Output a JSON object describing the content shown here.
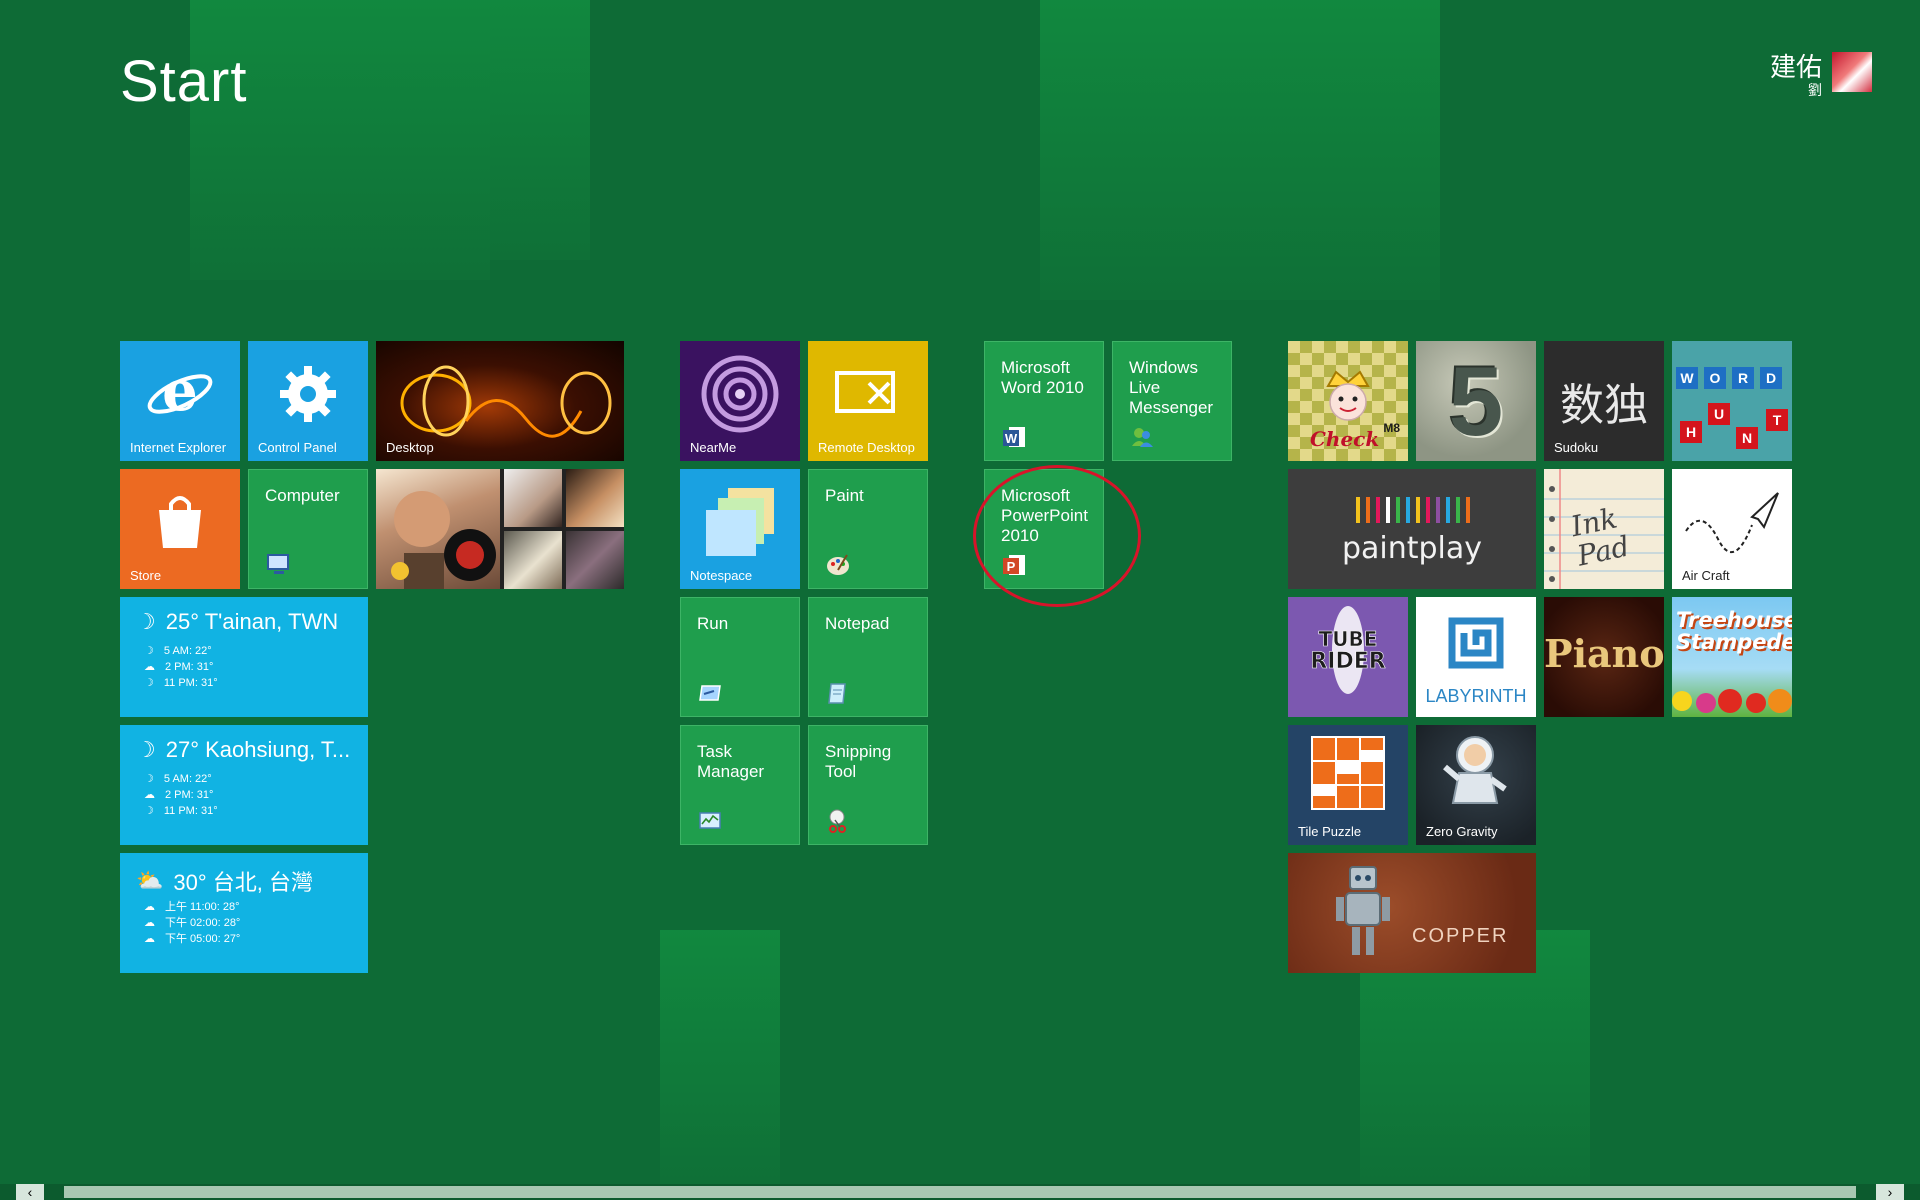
{
  "header": {
    "title": "Start"
  },
  "user": {
    "first_name": "建佑",
    "last_name": "劉"
  },
  "tiles": {
    "ie": "Internet Explorer",
    "control_panel": "Control Panel",
    "desktop": "Desktop",
    "store": "Store",
    "computer": "Computer",
    "nearme": "NearMe",
    "remote_desktop": "Remote Desktop",
    "notespace": "Notespace",
    "paint": "Paint",
    "run": "Run",
    "notepad": "Notepad",
    "task_manager": "Task\nManager",
    "snipping_tool": "Snipping\nTool",
    "word": "Microsoft\nWord 2010",
    "messenger": "Windows\nLive\nMessenger",
    "powerpoint": "Microsoft\nPowerPoint\n2010",
    "sudoku": "Sudoku",
    "sudoku_glyph": "数独",
    "paintplay": "paintplay",
    "inkpad": "Ink Pad",
    "aircraft": "Air Craft",
    "labyrinth": "LABYRINTH",
    "piano": "Piano",
    "treehouse": "Treehouse Stampede!",
    "tile_puzzle": "Tile Puzzle",
    "zero_gravity": "Zero Gravity",
    "copper": "COPPER",
    "tuberider": "TUBE RIDER",
    "check_badge": "Check",
    "check_sub": "M8",
    "five": "5",
    "word_hunt_letters": [
      "W",
      "O",
      "R",
      "D",
      "H",
      "U",
      "N",
      "T"
    ]
  },
  "weather": [
    {
      "main": "25° T'ainan, TWN",
      "rows": [
        "5 AM: 22°",
        "2 PM: 31°",
        "11 PM: 31°"
      ]
    },
    {
      "main": "27° Kaohsiung, T...",
      "rows": [
        "5 AM: 22°",
        "2 PM: 31°",
        "11 PM: 31°"
      ]
    },
    {
      "main": "30° 台北, 台灣",
      "rows": [
        "上午 11:00: 28°",
        "下午 02:00: 28°",
        "下午 05:00: 27°"
      ]
    }
  ],
  "colors": {
    "bg": "#0e6b36",
    "tile_green": "#1f9e4d",
    "weather": "#11b3e3",
    "annotation": "#d8142a"
  }
}
